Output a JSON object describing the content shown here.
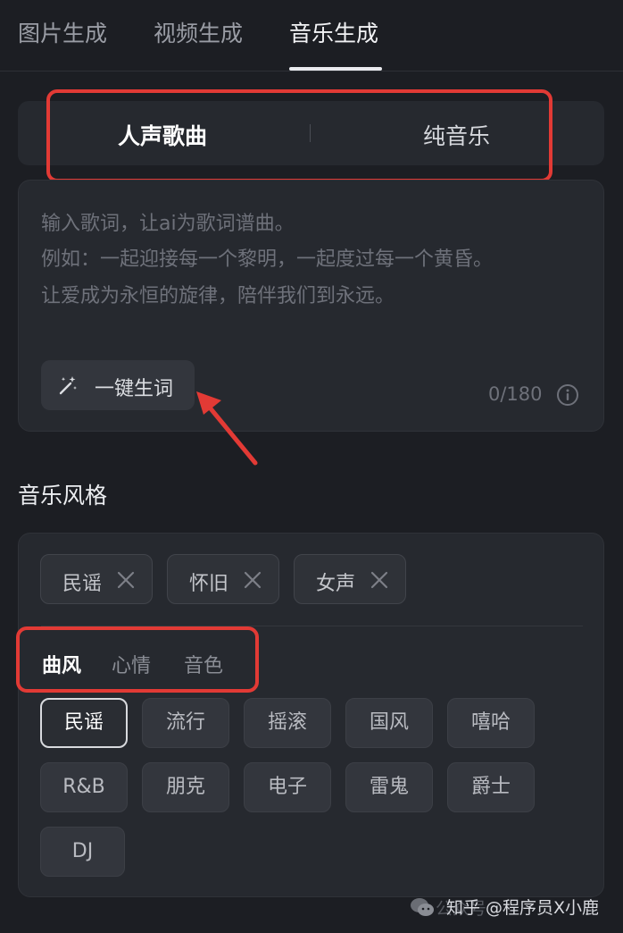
{
  "top_tabs": [
    {
      "label": "图片生成",
      "active": false
    },
    {
      "label": "视频生成",
      "active": false
    },
    {
      "label": "音乐生成",
      "active": true
    }
  ],
  "segment": [
    {
      "label": "人声歌曲",
      "active": true
    },
    {
      "label": "纯音乐",
      "active": false
    }
  ],
  "lyrics": {
    "placeholder_lines": [
      "输入歌词，让ai为歌词谱曲。",
      "例如：一起迎接每一个黎明，一起度过每一个黄昏。",
      "让爱成为永恒的旋律，陪伴我们到永远。"
    ],
    "generate_button": "一键生词",
    "counter": "0/180"
  },
  "style_section": {
    "title": "音乐风格",
    "selected_tags": [
      "民谣",
      "怀旧",
      "女声"
    ],
    "sub_tabs": [
      {
        "label": "曲风",
        "active": true
      },
      {
        "label": "心情",
        "active": false
      },
      {
        "label": "音色",
        "active": false
      }
    ],
    "options": [
      "民谣",
      "流行",
      "摇滚",
      "国风",
      "嘻哈",
      "R&B",
      "朋克",
      "电子",
      "雷鬼",
      "爵士",
      "DJ"
    ],
    "selected_option": "民谣"
  },
  "watermark": {
    "faint": "公众号",
    "text": "知乎 @程序员X小鹿"
  },
  "colors": {
    "background": "#1c1e23",
    "card": "#26292f",
    "annotation_red": "#e23a35",
    "active_text": "#ffffff",
    "muted_text": "#6e717a"
  },
  "icons": {
    "generate": "magic-wand-icon",
    "info": "info-icon",
    "remove": "close-icon",
    "watermark": "wechat-icon"
  }
}
